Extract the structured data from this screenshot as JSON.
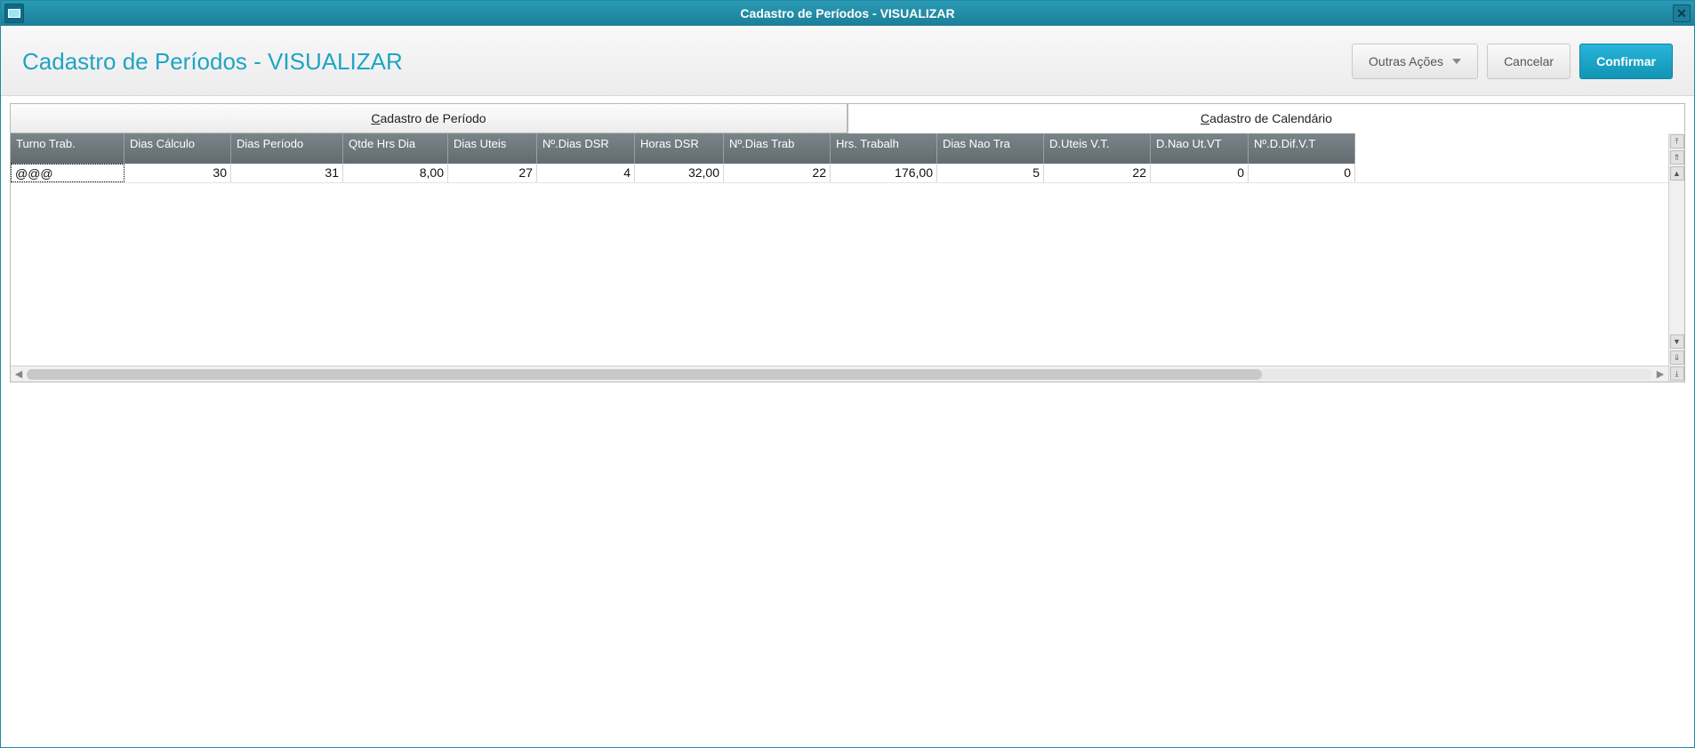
{
  "window": {
    "title": "Cadastro de Períodos - VISUALIZAR"
  },
  "header": {
    "page_title": "Cadastro de Períodos - VISUALIZAR",
    "buttons": {
      "other_actions": "Outras Ações",
      "cancel": "Cancelar",
      "confirm": "Confirmar"
    }
  },
  "tabs": {
    "periodo_prefix": "C",
    "periodo_rest": "adastro de Período",
    "calendario_prefix": "C",
    "calendario_rest": "adastro de Calendário"
  },
  "grid": {
    "columns": [
      "Turno Trab.",
      "Dias Cálculo",
      "Dias Período",
      "Qtde Hrs Dia",
      "Dias Uteis",
      "Nº.Dias DSR",
      "Horas DSR",
      "Nº.Dias Trab",
      "Hrs. Trabalh",
      "Dias Nao Tra",
      "D.Uteis V.T.",
      "D.Nao Ut.VT",
      "Nº.D.Dif.V.T"
    ],
    "rows": [
      {
        "c0": "@@@",
        "c1": "30",
        "c2": "31",
        "c3": "8,00",
        "c4": "27",
        "c5": "4",
        "c6": "32,00",
        "c7": "22",
        "c8": "176,00",
        "c9": "5",
        "c10": "22",
        "c11": "0",
        "c12": "0"
      }
    ]
  }
}
